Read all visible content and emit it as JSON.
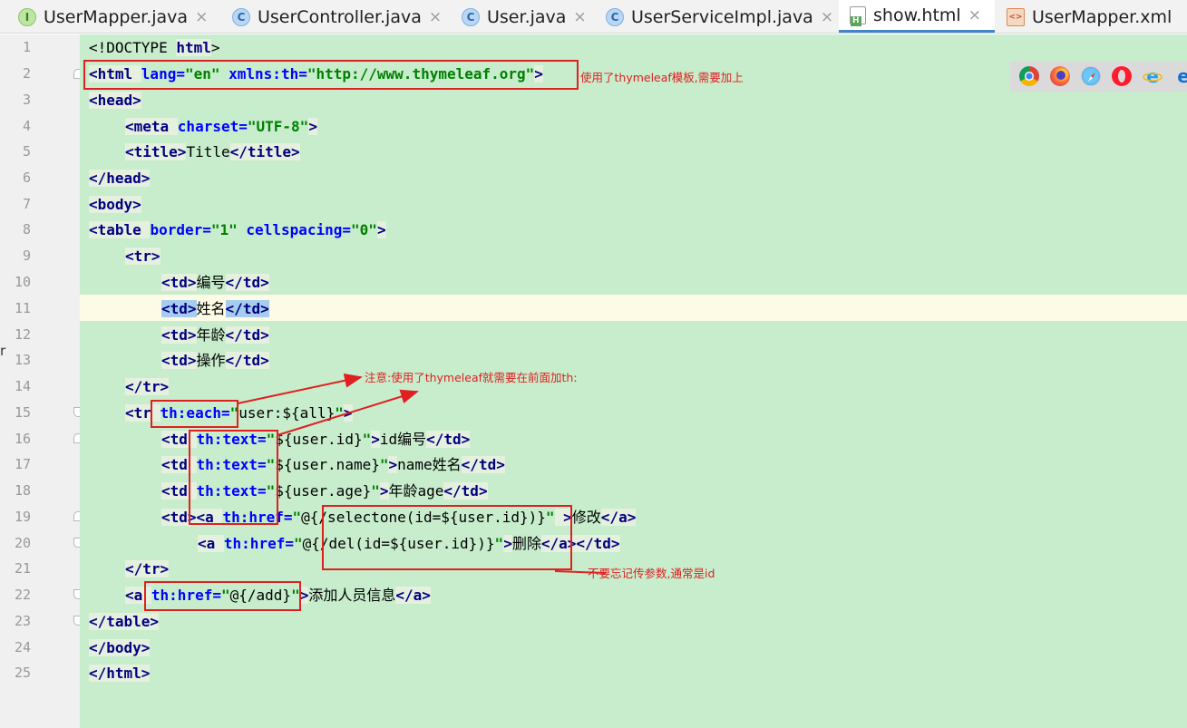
{
  "tabs": [
    {
      "label": "UserMapper.java",
      "icon": "interface-icon",
      "active": false
    },
    {
      "label": "UserController.java",
      "icon": "class-icon",
      "active": false
    },
    {
      "label": "User.java",
      "icon": "class-icon",
      "active": false
    },
    {
      "label": "UserServiceImpl.java",
      "icon": "class-icon",
      "active": false
    },
    {
      "label": "show.html",
      "icon": "html-file-icon",
      "active": true
    },
    {
      "label": "UserMapper.xml",
      "icon": "xml-file-icon",
      "active": false
    }
  ],
  "tab_close_glyph": "×",
  "line_numbers": [
    "1",
    "2",
    "3",
    "4",
    "5",
    "6",
    "7",
    "8",
    "9",
    "10",
    "11",
    "12",
    "13",
    "14",
    "15",
    "16",
    "17",
    "18",
    "19",
    "20",
    "21",
    "22",
    "23",
    "24",
    "25"
  ],
  "current_line": "11",
  "code": {
    "l1": [
      "<!DOCTYPE ",
      "html",
      ">"
    ],
    "l2": [
      "<html ",
      "lang",
      "=",
      "\"en\"",
      " ",
      "xmlns:th",
      "=",
      "\"http://www.thymeleaf.org\"",
      ">"
    ],
    "l3": [
      "<head>"
    ],
    "l4": [
      "<meta ",
      "charset",
      "=",
      "\"UTF-8\"",
      ">"
    ],
    "l5": [
      "<title>",
      "Title",
      "</title>"
    ],
    "l6": [
      "</head>"
    ],
    "l7": [
      "<body>"
    ],
    "l8": [
      "<table ",
      "border",
      "=",
      "\"1\"",
      " ",
      "cellspacing",
      "=",
      "\"0\"",
      ">"
    ],
    "l9": [
      "<tr>"
    ],
    "l10": [
      "<td>",
      "编号",
      "</td>"
    ],
    "l11": [
      "<td>",
      "姓名",
      "</td>"
    ],
    "l12": [
      "<td>",
      "年龄",
      "</td>"
    ],
    "l13": [
      "<td>",
      "操作",
      "</td>"
    ],
    "l14": [
      "</tr>"
    ],
    "l15": [
      "<tr ",
      "th:each",
      "=",
      "\"",
      "user:${all}",
      "\"",
      ">"
    ],
    "l16": [
      "<td ",
      "th:text",
      "=",
      "\"",
      "${user.id}",
      "\"",
      ">",
      "id编号",
      "</td>"
    ],
    "l17": [
      "<td ",
      "th:text",
      "=",
      "\"",
      "${user.name}",
      "\"",
      ">",
      "name姓名",
      "</td>"
    ],
    "l18": [
      "<td ",
      "th:text",
      "=",
      "\"",
      "${user.age}",
      "\"",
      ">",
      "年龄age",
      "</td>"
    ],
    "l19": [
      "<td>",
      "<a ",
      "th:href",
      "=",
      "\"",
      "@{/selectone(id=",
      "${user.id}",
      ")}",
      "\"",
      " >",
      "修改",
      "</a>"
    ],
    "l20": [
      "<a ",
      "th:href",
      "=",
      "\"",
      "@{/del(id=",
      "${user.id}",
      ")}",
      "\"",
      ">",
      "删除",
      "</a>",
      "</td>"
    ],
    "l21": [
      "</tr>"
    ],
    "l22": [
      "<a ",
      "th:href",
      "=",
      "\"",
      "@{/add}",
      "\"",
      ">",
      "添加人员信息",
      "</a>"
    ],
    "l23": [
      "</table>"
    ],
    "l24": [
      "</body>"
    ],
    "l25": [
      "</html>"
    ]
  },
  "annotations": {
    "note1": "使用了thymeleaf模板,需要加上",
    "note2": "注意:使用了thymeleaf就需要在前面加th:",
    "note3": "不要忘记传参数,通常是id"
  },
  "browsers": [
    "chrome-icon",
    "firefox-icon",
    "safari-icon",
    "opera-icon",
    "ie-icon",
    "edge-icon"
  ],
  "colors": {
    "editor_bg": "#c7edcc",
    "tag": "#000080",
    "attribute": "#0000ff",
    "value": "#008000",
    "annotation": "#e02020",
    "active_tab_underline": "#4083c9"
  },
  "left_stub": "r"
}
